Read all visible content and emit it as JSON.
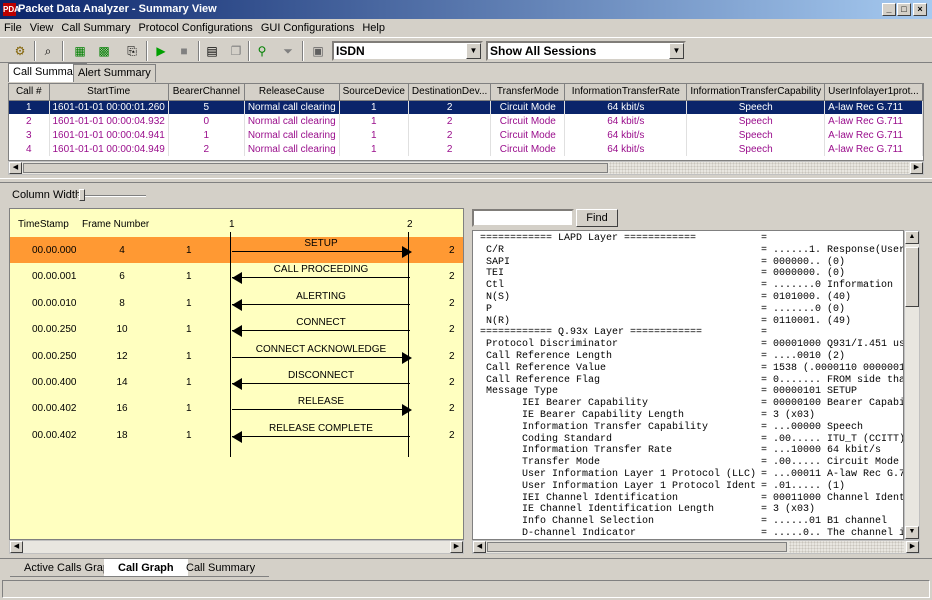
{
  "window": {
    "title": "Packet Data Analyzer - Summary View",
    "app_icon_label": "PDA"
  },
  "menu": [
    "File",
    "View",
    "Call Summary",
    "Protocol Configurations",
    "GUI Configurations",
    "Help"
  ],
  "toolbar": {
    "protocol_value": "ISDN",
    "session_value": "Show All Sessions"
  },
  "top_tabs": [
    "Call Summary",
    "Alert Summary"
  ],
  "table": {
    "columns": [
      "Call #",
      "StartTime",
      "BearerChannel",
      "ReleaseCause",
      "SourceDevice",
      "DestinationDev...",
      "TransferMode",
      "InformationTransferRate",
      "InformationTransferCapability",
      "UserInfolayer1prot..."
    ],
    "rows": [
      [
        "1",
        "1601-01-01 00:00:01.260",
        "5",
        "Normal call clearing",
        "1",
        "2",
        "Circuit Mode",
        "64 kbit/s",
        "Speech",
        "A-law Rec G.711"
      ],
      [
        "2",
        "1601-01-01 00:00:04.932",
        "0",
        "Normal call clearing",
        "1",
        "2",
        "Circuit Mode",
        "64 kbit/s",
        "Speech",
        "A-law Rec G.711"
      ],
      [
        "3",
        "1601-01-01 00:00:04.941",
        "1",
        "Normal call clearing",
        "1",
        "2",
        "Circuit Mode",
        "64 kbit/s",
        "Speech",
        "A-law Rec G.711"
      ],
      [
        "4",
        "1601-01-01 00:00:04.949",
        "2",
        "Normal call clearing",
        "1",
        "2",
        "Circuit Mode",
        "64 kbit/s",
        "Speech",
        "A-law Rec G.711"
      ]
    ]
  },
  "column_width_label": "Column Width",
  "graph": {
    "headers": {
      "timestamp": "TimeStamp",
      "frame": "Frame Number",
      "dev1": "1",
      "dev2": "2"
    },
    "rows": [
      {
        "ts": "00.00.000",
        "frame": "4",
        "src": "1",
        "dst": "2",
        "msg": "SETUP",
        "dir": "r"
      },
      {
        "ts": "00.00.001",
        "frame": "6",
        "src": "1",
        "dst": "2",
        "msg": "CALL PROCEEDING",
        "dir": "l"
      },
      {
        "ts": "00.00.010",
        "frame": "8",
        "src": "1",
        "dst": "2",
        "msg": "ALERTING",
        "dir": "l"
      },
      {
        "ts": "00.00.250",
        "frame": "10",
        "src": "1",
        "dst": "2",
        "msg": "CONNECT",
        "dir": "l"
      },
      {
        "ts": "00.00.250",
        "frame": "12",
        "src": "1",
        "dst": "2",
        "msg": "CONNECT ACKNOWLEDGE",
        "dir": "r"
      },
      {
        "ts": "00.00.400",
        "frame": "14",
        "src": "1",
        "dst": "2",
        "msg": "DISCONNECT",
        "dir": "l"
      },
      {
        "ts": "00.00.402",
        "frame": "16",
        "src": "1",
        "dst": "2",
        "msg": "RELEASE",
        "dir": "r"
      },
      {
        "ts": "00.00.402",
        "frame": "18",
        "src": "1",
        "dst": "2",
        "msg": "RELEASE COMPLETE",
        "dir": "l"
      }
    ]
  },
  "find": {
    "button": "Find",
    "value": ""
  },
  "decode": [
    [
      "============ LAPD Layer ============",
      "="
    ],
    [
      " C/R",
      "= ......1. Response(User)"
    ],
    [
      " SAPI",
      "= 000000.. (0)"
    ],
    [
      " TEI",
      "= 0000000. (0)"
    ],
    [
      " Ctl",
      "= .......0 Information"
    ],
    [
      " N(S)",
      "= 0101000. (40)"
    ],
    [
      " P",
      "= .......0 (0)"
    ],
    [
      " N(R)",
      "= 0110001. (49)"
    ],
    [
      "============ Q.93x Layer ============",
      "="
    ],
    [
      " Protocol Discriminator",
      "= 00001000 Q931/I.451 use"
    ],
    [
      " Call Reference Length",
      "= ....0010 (2)"
    ],
    [
      " Call Reference Value",
      "= 1538 (.0000110 0000001("
    ],
    [
      " Call Reference Flag",
      "= 0....... FROM side that"
    ],
    [
      " Message Type",
      "= 00000101 SETUP"
    ],
    [
      "       IEI Bearer Capability",
      "= 00000100 Bearer Capabil"
    ],
    [
      "       IE Bearer Capability Length",
      "= 3 (x03)"
    ],
    [
      "       Information Transfer Capability",
      "= ...00000 Speech"
    ],
    [
      "       Coding Standard",
      "= .00..... ITU_T (CCITT)"
    ],
    [
      "       Information Transfer Rate",
      "= ...10000 64 kbit/s"
    ],
    [
      "       Transfer Mode",
      "= .00..... Circuit Mode"
    ],
    [
      "       User Information Layer 1 Protocol (LLC)",
      "= ...00011 A-law Rec G.7"
    ],
    [
      "       User Information Layer 1 Protocol Ident",
      "= .01..... (1)"
    ],
    [
      "       IEI Channel Identification",
      "= 00011000 Channel Identi"
    ],
    [
      "       IE Channel Identification Length",
      "= 3 (x03)"
    ],
    [
      "       Info Channel Selection",
      "= ......01 B1 channel"
    ],
    [
      "       D-channel Indicator",
      "= .....0.. The channel id"
    ]
  ],
  "bottom_tabs": [
    "Active Calls Graph",
    "Call Graph",
    "Call Summary"
  ],
  "colors": {
    "accent": "#0a246a",
    "highlight_row": "#ff9933",
    "graph_bg": "#ffffc0",
    "cell_text": "#9a0e8c"
  }
}
